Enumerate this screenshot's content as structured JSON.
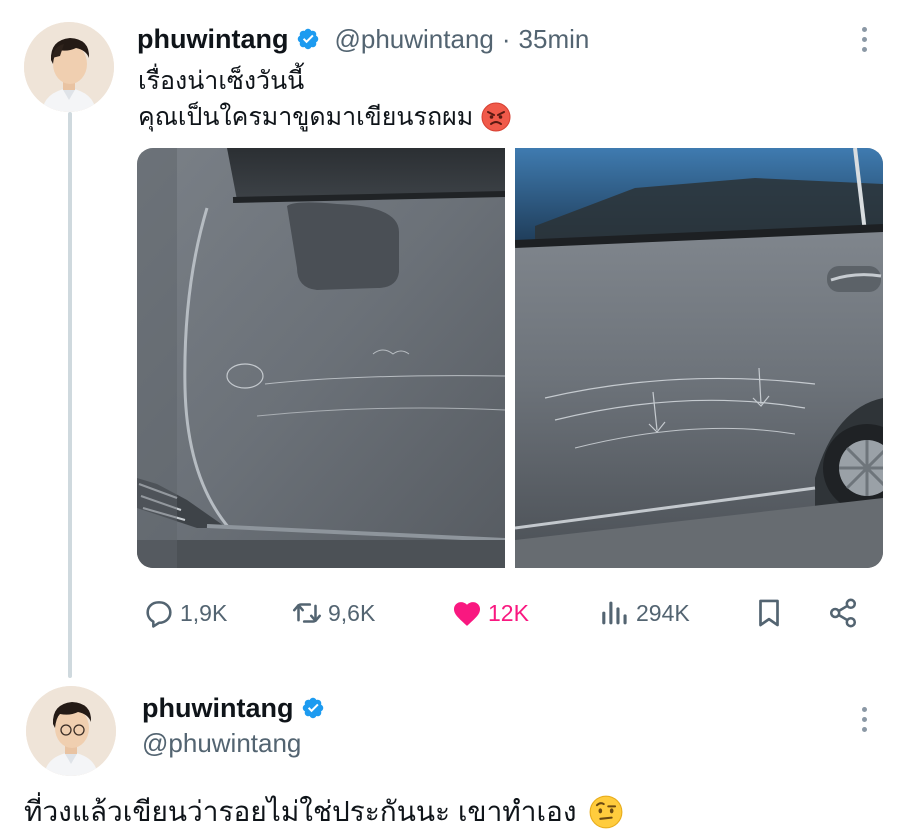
{
  "tweet": {
    "author_name": "phuwintang",
    "author_handle": "@phuwintang",
    "separator": "·",
    "time": "35min",
    "text_line1": "เรื่องน่าเซ็งวันนี้",
    "text_line2": "คุณเป็นใครมาขูดมาเขียนรถผม",
    "text_line2_emoji": "angry-face-emoji",
    "media": [
      {
        "icon": "car-door-photo-left"
      },
      {
        "icon": "car-door-photo-right"
      }
    ],
    "stats": {
      "replies": "1,9K",
      "retweets": "9,6K",
      "likes": "12K",
      "views": "294K"
    },
    "liked": true
  },
  "reply": {
    "author_name": "phuwintang",
    "author_handle": "@phuwintang",
    "text": "ที่วงแล้วเขียนว่ารอยไม่ใช่ประกันนะ เขาทำเอง",
    "text_emoji": "face-with-raised-eyebrow-emoji"
  },
  "colors": {
    "verified": "#1d9bf0",
    "like": "#f91880",
    "muted": "#536471",
    "thread_line": "#cfd9de"
  }
}
